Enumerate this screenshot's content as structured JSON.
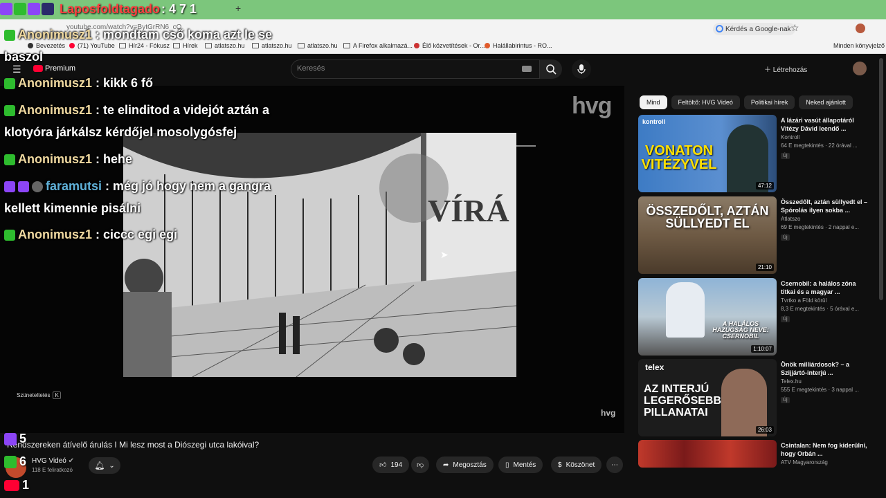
{
  "browser": {
    "url": "youtube.com/watch?v=BytGrRN6_cQ",
    "ask_google": "Kérdés a Google-nak",
    "bookmarks": [
      "Bevezetés",
      "(71) YouTube",
      "Hír24 - Fókusz",
      "Hírek",
      "atlatszo.hu",
      "atlatszo.hu",
      "atlatszo.hu",
      "A Firefox alkalmazá...",
      "Élő közvetítések - Or...",
      "Halállabirintus - RO..."
    ],
    "bookmarks_right": "Minden könyvjelző"
  },
  "youtube": {
    "premium": "Premium",
    "search_placeholder": "Keresés",
    "create": "Létrehozás",
    "watermark": "hvg",
    "watermark_small": "hvg",
    "pause_hint": "Szüneteltetés",
    "pause_key": "K",
    "video_title": "Rendszereken átívelő árulás I Mi lesz most a Diószegi utca lakóival?",
    "channel": "HVG Videó",
    "subscribers": "118 E feliratkozó",
    "likes": "194",
    "share": "Megosztás",
    "save": "Mentés",
    "thanks": "Köszönet",
    "video_sign": "VÍRÁ"
  },
  "chips": [
    "Mind",
    "Feltöltő: HVG Videó",
    "Politikai hírek",
    "Neked ajánlott"
  ],
  "recommendations": [
    {
      "title": "A lázári vasút állapotáról Vitézy Dávid leendő ...",
      "channel": "Kontroll",
      "meta": "64 E megtekintés · 22 órával ...",
      "badge": "Új",
      "duration": "47:12",
      "thumb_text": "VONATON VITÉZYVEL",
      "thumb_brand": "kontroll"
    },
    {
      "title": "Összedőlt, aztán süllyedt el – Spórolás ilyen sokba ...",
      "channel": "Atlatszo",
      "meta": "69 E megtekintés · 2 nappal e...",
      "badge": "Új",
      "duration": "21:10",
      "thumb_text": "ÖSSZEDŐLT, AZTÁN SÜLLYEDT EL"
    },
    {
      "title": "Csernobil: a halálos zóna titkai és a magyar ...",
      "channel": "Tvrtko a Föld körül",
      "meta": "8,3 E megtekintés · 5 órával e...",
      "badge": "Új",
      "duration": "1:10:07",
      "thumb_text": "A HALÁLOS HAZUGSÁG NEVE: CSERNOBIL"
    },
    {
      "title": "Önök milliárdosok? – a Szijjártó-interjú ...",
      "channel": "Telex.hu",
      "meta": "555 E megtekintés · 3 nappal ...",
      "badge": "Új",
      "duration": "26:03",
      "thumb_text": "AZ INTERJÚ LEGERŐSEBB PILLANATAI",
      "thumb_brand": "telex"
    },
    {
      "title": "Csintalan: Nem fog kiderülni, hogy Orbán ...",
      "channel": "ATV Magyarország",
      "meta": "",
      "badge": "",
      "duration": "",
      "thumb_text": ""
    }
  ],
  "overlay": {
    "ticker_name": "Laposfoldtagado",
    "ticker_value": ": 4 7 1",
    "chat": [
      {
        "user": "Anonimusz1",
        "text": " : mondtam cső koma azt le se baszol"
      },
      {
        "user": "Anonimusz1",
        "text": " : kikk 6 fő"
      },
      {
        "user": "Anonimusz1",
        "text": " : te elinditod a videjót aztán a klotyóra járkálsz kérdőjel mosolygósfej"
      },
      {
        "user": "Anonimusz1",
        "text": " : hehe"
      },
      {
        "user": "faramutsi",
        "text": " : még jó hogy nem a gangra kellett kimennie pisálni"
      },
      {
        "user": "Anonimusz1",
        "text": " : ciccc egi egi"
      }
    ],
    "counts": {
      "twitch": "5",
      "kick": "6",
      "youtube": "1"
    }
  },
  "colors": {
    "accent": "#ff0033",
    "chat_user": "#f0d9a0",
    "chat_user2": "#5fb0d8",
    "kick_green": "#2ebc2e",
    "twitch_purple": "#8c45f7"
  }
}
